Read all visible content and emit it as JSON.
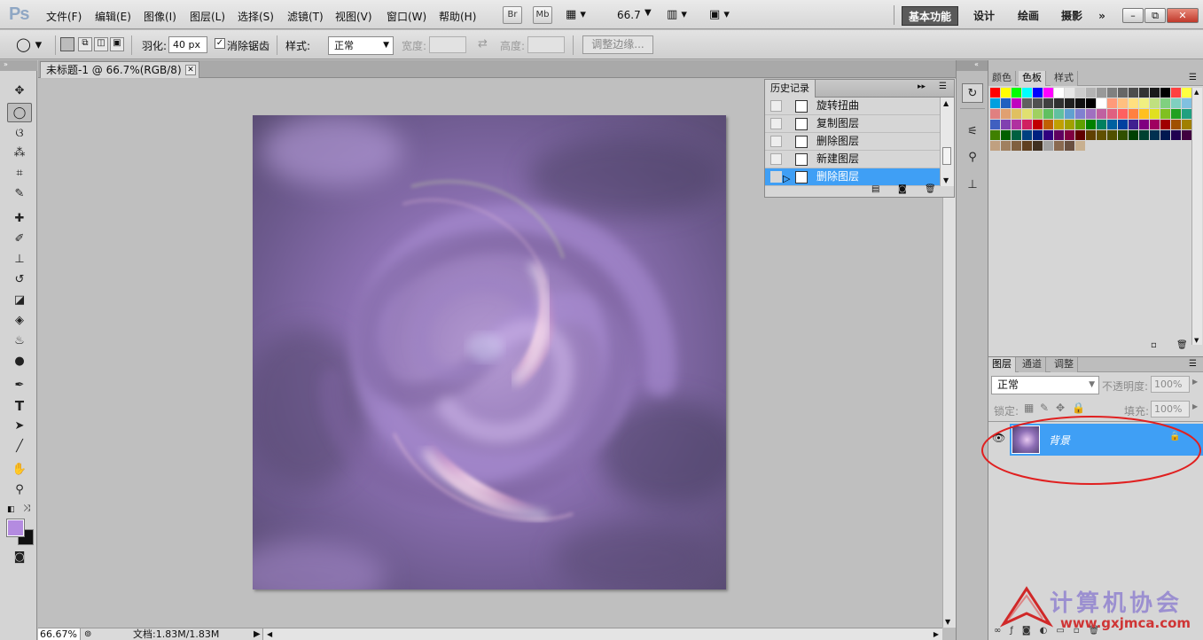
{
  "app": {
    "logo": "Ps"
  },
  "menu": [
    "文件(F)",
    "编辑(E)",
    "图像(I)",
    "图层(L)",
    "选择(S)",
    "滤镜(T)",
    "视图(V)",
    "窗口(W)",
    "帮助(H)"
  ],
  "appbar": {
    "bridge": "Br",
    "minibridge": "Mb",
    "zoom": "66.7"
  },
  "workspaces": {
    "active": "基本功能",
    "design": "设计",
    "paint": "绘画",
    "photo": "摄影",
    "more": "»"
  },
  "window_controls": {
    "minimize": "–",
    "restore": "⧉",
    "close": "✕"
  },
  "options": {
    "feather_label": "羽化:",
    "feather_value": "40 px",
    "antialias_label": "消除锯齿",
    "antialias_checked": true,
    "style_label": "样式:",
    "style_value": "正常",
    "width_label": "宽度:",
    "height_label": "高度:",
    "refine_button": "调整边缘..."
  },
  "document": {
    "tab_title": "未标题-1 @ 66.7%(RGB/8) *",
    "close": "✕"
  },
  "status": {
    "zoom": "66.67%",
    "doc_info": "文档:1.83M/1.83M"
  },
  "history": {
    "title": "历史记录",
    "items": [
      {
        "label": "旋转扭曲",
        "selected": false
      },
      {
        "label": "复制图层",
        "selected": false
      },
      {
        "label": "删除图层",
        "selected": false
      },
      {
        "label": "新建图层",
        "selected": false
      },
      {
        "label": "删除图层",
        "selected": true
      }
    ]
  },
  "swatch_tabs": [
    "颜色",
    "色板",
    "样式"
  ],
  "layers": {
    "tabs": [
      "图层",
      "通道",
      "调整"
    ],
    "blend_mode": "正常",
    "opacity_label": "不透明度:",
    "opacity_value": "100%",
    "lock_label": "锁定:",
    "fill_label": "填充:",
    "fill_value": "100%",
    "items": [
      {
        "name": "背景",
        "visible": true,
        "locked": true,
        "selected": true
      }
    ]
  },
  "colors": {
    "foreground": "#b48be0",
    "background": "#111111",
    "accent": "#3f9ff5",
    "annotation": "#e02020"
  },
  "watermark": {
    "title": "计算机协会",
    "url": "www.gxjmca.com"
  },
  "swatches": [
    "#ff0000",
    "#ffff00",
    "#00ff00",
    "#00ffff",
    "#0000ff",
    "#ff00ff",
    "#ffffff",
    "#e6e6e6",
    "#cccccc",
    "#b3b3b3",
    "#999999",
    "#808080",
    "#666666",
    "#4d4d4d",
    "#333333",
    "#1a1a1a",
    "#000000",
    "#ff4040",
    "#ffff40",
    "#40c040",
    "#00a0e0",
    "#2060c0",
    "#c000c0",
    "#606060",
    "#505050",
    "#404040",
    "#303030",
    "#202020",
    "#101010",
    "#000000",
    "#ffffff",
    "#ff9a7a",
    "#ffc080",
    "#ffe080",
    "#f0f080",
    "#c0e080",
    "#80d080",
    "#80d0c0",
    "#80c0e0",
    "#a0a0e0",
    "#e08080",
    "#e0a070",
    "#e0c060",
    "#e0e070",
    "#a0d060",
    "#60c060",
    "#60c0a0",
    "#60a0d0",
    "#8080d0",
    "#a070c0",
    "#c060a0",
    "#e06080",
    "#ff6060",
    "#ff8040",
    "#ffc020",
    "#e0e020",
    "#80c020",
    "#20a020",
    "#20a080",
    "#2080c0",
    "#4060c0",
    "#8040b0",
    "#b030a0",
    "#d02060",
    "#c00000",
    "#c06000",
    "#c0a000",
    "#a0a000",
    "#60a000",
    "#008000",
    "#008060",
    "#0060a0",
    "#0040a0",
    "#402090",
    "#800080",
    "#a00060",
    "#a00000",
    "#a05000",
    "#a08000",
    "#808000",
    "#408000",
    "#006000",
    "#006040",
    "#004080",
    "#002080",
    "#300080",
    "#600060",
    "#800040",
    "#600000",
    "#604000",
    "#605000",
    "#505000",
    "#305000",
    "#004000",
    "#004030",
    "#003050",
    "#001850",
    "#200050",
    "#400040",
    "#500030",
    "#c0a080",
    "#a08060",
    "#806040",
    "#604020",
    "#403020",
    "#a0a0a0",
    "#8a6a50",
    "#6a5040",
    "#c8b090"
  ]
}
